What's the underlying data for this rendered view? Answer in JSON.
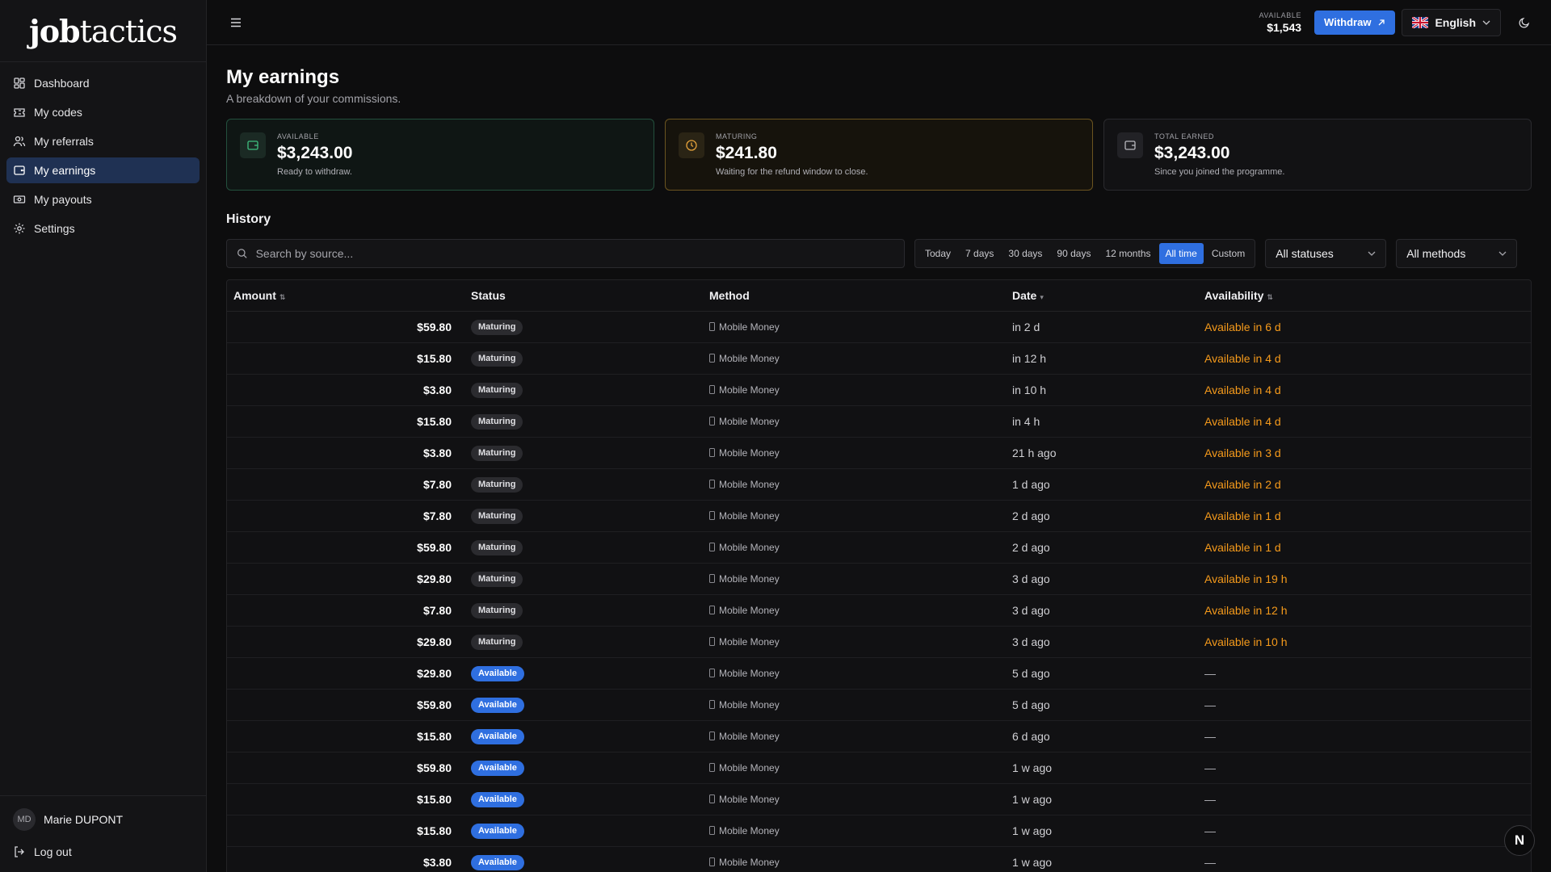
{
  "brand": {
    "bold": "job",
    "light": "tactics"
  },
  "sidebar": {
    "items": [
      {
        "label": "Dashboard",
        "icon": "dashboard-icon",
        "active": false
      },
      {
        "label": "My codes",
        "icon": "ticket-icon",
        "active": false
      },
      {
        "label": "My referrals",
        "icon": "users-icon",
        "active": false
      },
      {
        "label": "My earnings",
        "icon": "wallet-icon",
        "active": true
      },
      {
        "label": "My payouts",
        "icon": "banknote-icon",
        "active": false
      },
      {
        "label": "Settings",
        "icon": "gear-icon",
        "active": false
      }
    ],
    "user": {
      "initials": "MD",
      "name": "Marie DUPONT"
    },
    "logout_label": "Log out"
  },
  "topbar": {
    "balance_label": "AVAILABLE",
    "balance_value": "$1,543",
    "withdraw_label": "Withdraw",
    "language": "English"
  },
  "page": {
    "title": "My earnings",
    "subtitle": "A breakdown of your commissions."
  },
  "cards": {
    "available": {
      "label": "AVAILABLE",
      "value": "$3,243.00",
      "desc": "Ready to withdraw."
    },
    "maturing": {
      "label": "MATURING",
      "value": "$241.80",
      "desc": "Waiting for the refund window to close."
    },
    "total": {
      "label": "TOTAL EARNED",
      "value": "$3,243.00",
      "desc": "Since you joined the programme."
    }
  },
  "history": {
    "title": "History",
    "search_placeholder": "Search by source...",
    "ranges": [
      "Today",
      "7 days",
      "30 days",
      "90 days",
      "12 months",
      "All time",
      "Custom"
    ],
    "active_range": "All time",
    "status_filter": "All statuses",
    "method_filter": "All methods",
    "columns": {
      "amount": "Amount",
      "status": "Status",
      "method": "Method",
      "date": "Date",
      "availability": "Availability"
    },
    "rows": [
      {
        "amount": "$59.80",
        "status": "Maturing",
        "method": "Mobile Money",
        "date": "in 2 d",
        "availability": "Available in 6 d"
      },
      {
        "amount": "$15.80",
        "status": "Maturing",
        "method": "Mobile Money",
        "date": "in 12 h",
        "availability": "Available in 4 d"
      },
      {
        "amount": "$3.80",
        "status": "Maturing",
        "method": "Mobile Money",
        "date": "in 10 h",
        "availability": "Available in 4 d"
      },
      {
        "amount": "$15.80",
        "status": "Maturing",
        "method": "Mobile Money",
        "date": "in 4 h",
        "availability": "Available in 4 d"
      },
      {
        "amount": "$3.80",
        "status": "Maturing",
        "method": "Mobile Money",
        "date": "21 h ago",
        "availability": "Available in 3 d"
      },
      {
        "amount": "$7.80",
        "status": "Maturing",
        "method": "Mobile Money",
        "date": "1 d ago",
        "availability": "Available in 2 d"
      },
      {
        "amount": "$7.80",
        "status": "Maturing",
        "method": "Mobile Money",
        "date": "2 d ago",
        "availability": "Available in 1 d"
      },
      {
        "amount": "$59.80",
        "status": "Maturing",
        "method": "Mobile Money",
        "date": "2 d ago",
        "availability": "Available in 1 d"
      },
      {
        "amount": "$29.80",
        "status": "Maturing",
        "method": "Mobile Money",
        "date": "3 d ago",
        "availability": "Available in 19 h"
      },
      {
        "amount": "$7.80",
        "status": "Maturing",
        "method": "Mobile Money",
        "date": "3 d ago",
        "availability": "Available in 12 h"
      },
      {
        "amount": "$29.80",
        "status": "Maturing",
        "method": "Mobile Money",
        "date": "3 d ago",
        "availability": "Available in 10 h"
      },
      {
        "amount": "$29.80",
        "status": "Available",
        "method": "Mobile Money",
        "date": "5 d ago",
        "availability": "—"
      },
      {
        "amount": "$59.80",
        "status": "Available",
        "method": "Mobile Money",
        "date": "5 d ago",
        "availability": "—"
      },
      {
        "amount": "$15.80",
        "status": "Available",
        "method": "Mobile Money",
        "date": "6 d ago",
        "availability": "—"
      },
      {
        "amount": "$59.80",
        "status": "Available",
        "method": "Mobile Money",
        "date": "1 w ago",
        "availability": "—"
      },
      {
        "amount": "$15.80",
        "status": "Available",
        "method": "Mobile Money",
        "date": "1 w ago",
        "availability": "—"
      },
      {
        "amount": "$15.80",
        "status": "Available",
        "method": "Mobile Money",
        "date": "1 w ago",
        "availability": "—"
      },
      {
        "amount": "$3.80",
        "status": "Available",
        "method": "Mobile Money",
        "date": "1 w ago",
        "availability": "—"
      }
    ]
  },
  "fab_label": "N",
  "colors": {
    "accent": "#2f6fe0",
    "warning": "#f59a1b",
    "available_border": "#23503d",
    "maturing_border": "#6b5420"
  }
}
